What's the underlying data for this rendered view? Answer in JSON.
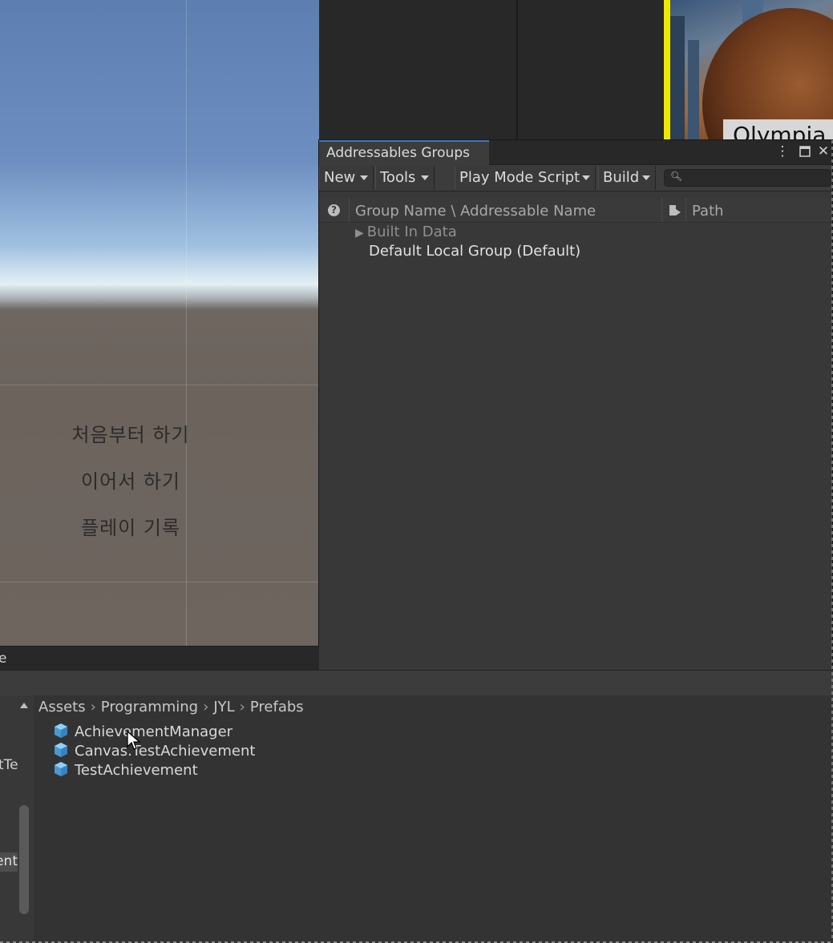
{
  "scene": {
    "menu_items": [
      "처음부터 하기",
      "이어서 하기",
      "플레이 기록"
    ]
  },
  "thumbnail": {
    "label": "Olympia"
  },
  "addressables": {
    "window_title": "Addressables Groups",
    "toolbar": {
      "new_label": "New",
      "tools_label": "Tools",
      "play_mode_label": "Play Mode Script",
      "build_label": "Build",
      "search_value": ""
    },
    "header": {
      "help_icon": "help-icon",
      "group_name_col": "Group Name \\ Addressable Name",
      "path_col": "Path"
    },
    "rows": [
      {
        "label": "Built In Data",
        "collapsed": true,
        "dimmed": true
      },
      {
        "label": "Default Local Group (Default)",
        "collapsed": false,
        "dimmed": false
      }
    ]
  },
  "project": {
    "title_fragment": "e",
    "breadcrumb": [
      "Assets",
      "Programming",
      "JYL",
      "Prefabs"
    ],
    "assets": [
      "AchievementManager",
      "Canvas.TestAchievement",
      "TestAchievement"
    ],
    "left_fragments": [
      "tTe",
      "ent"
    ]
  },
  "colors": {
    "accent_tab": "#3a79bb",
    "prefab_icon": "#6ab4e8",
    "yellow_bar": "#f0e600"
  }
}
